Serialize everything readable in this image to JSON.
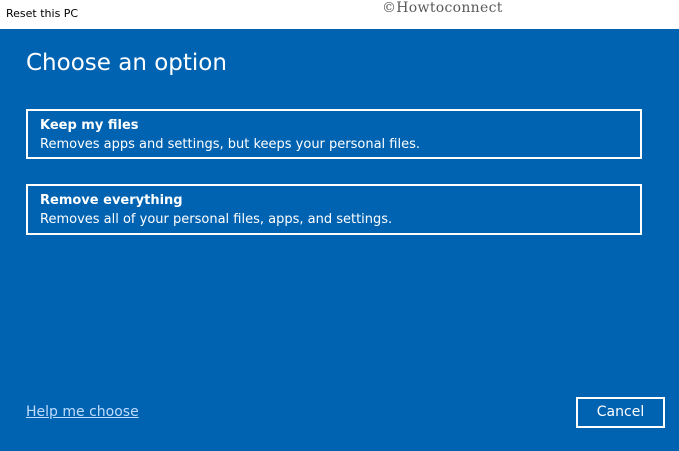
{
  "window": {
    "title": "Reset this PC"
  },
  "watermark": "©Howtoconnect",
  "dialog": {
    "heading": "Choose an option",
    "options": [
      {
        "title": "Keep my files",
        "description": "Removes apps and settings, but keeps your personal files."
      },
      {
        "title": "Remove everything",
        "description": "Removes all of your personal files, apps, and settings."
      }
    ],
    "help_link": "Help me choose",
    "cancel_label": "Cancel"
  },
  "colors": {
    "background": "#0063b1",
    "titlebar": "#ffffff",
    "text": "#ffffff",
    "link": "#bfdcff"
  }
}
